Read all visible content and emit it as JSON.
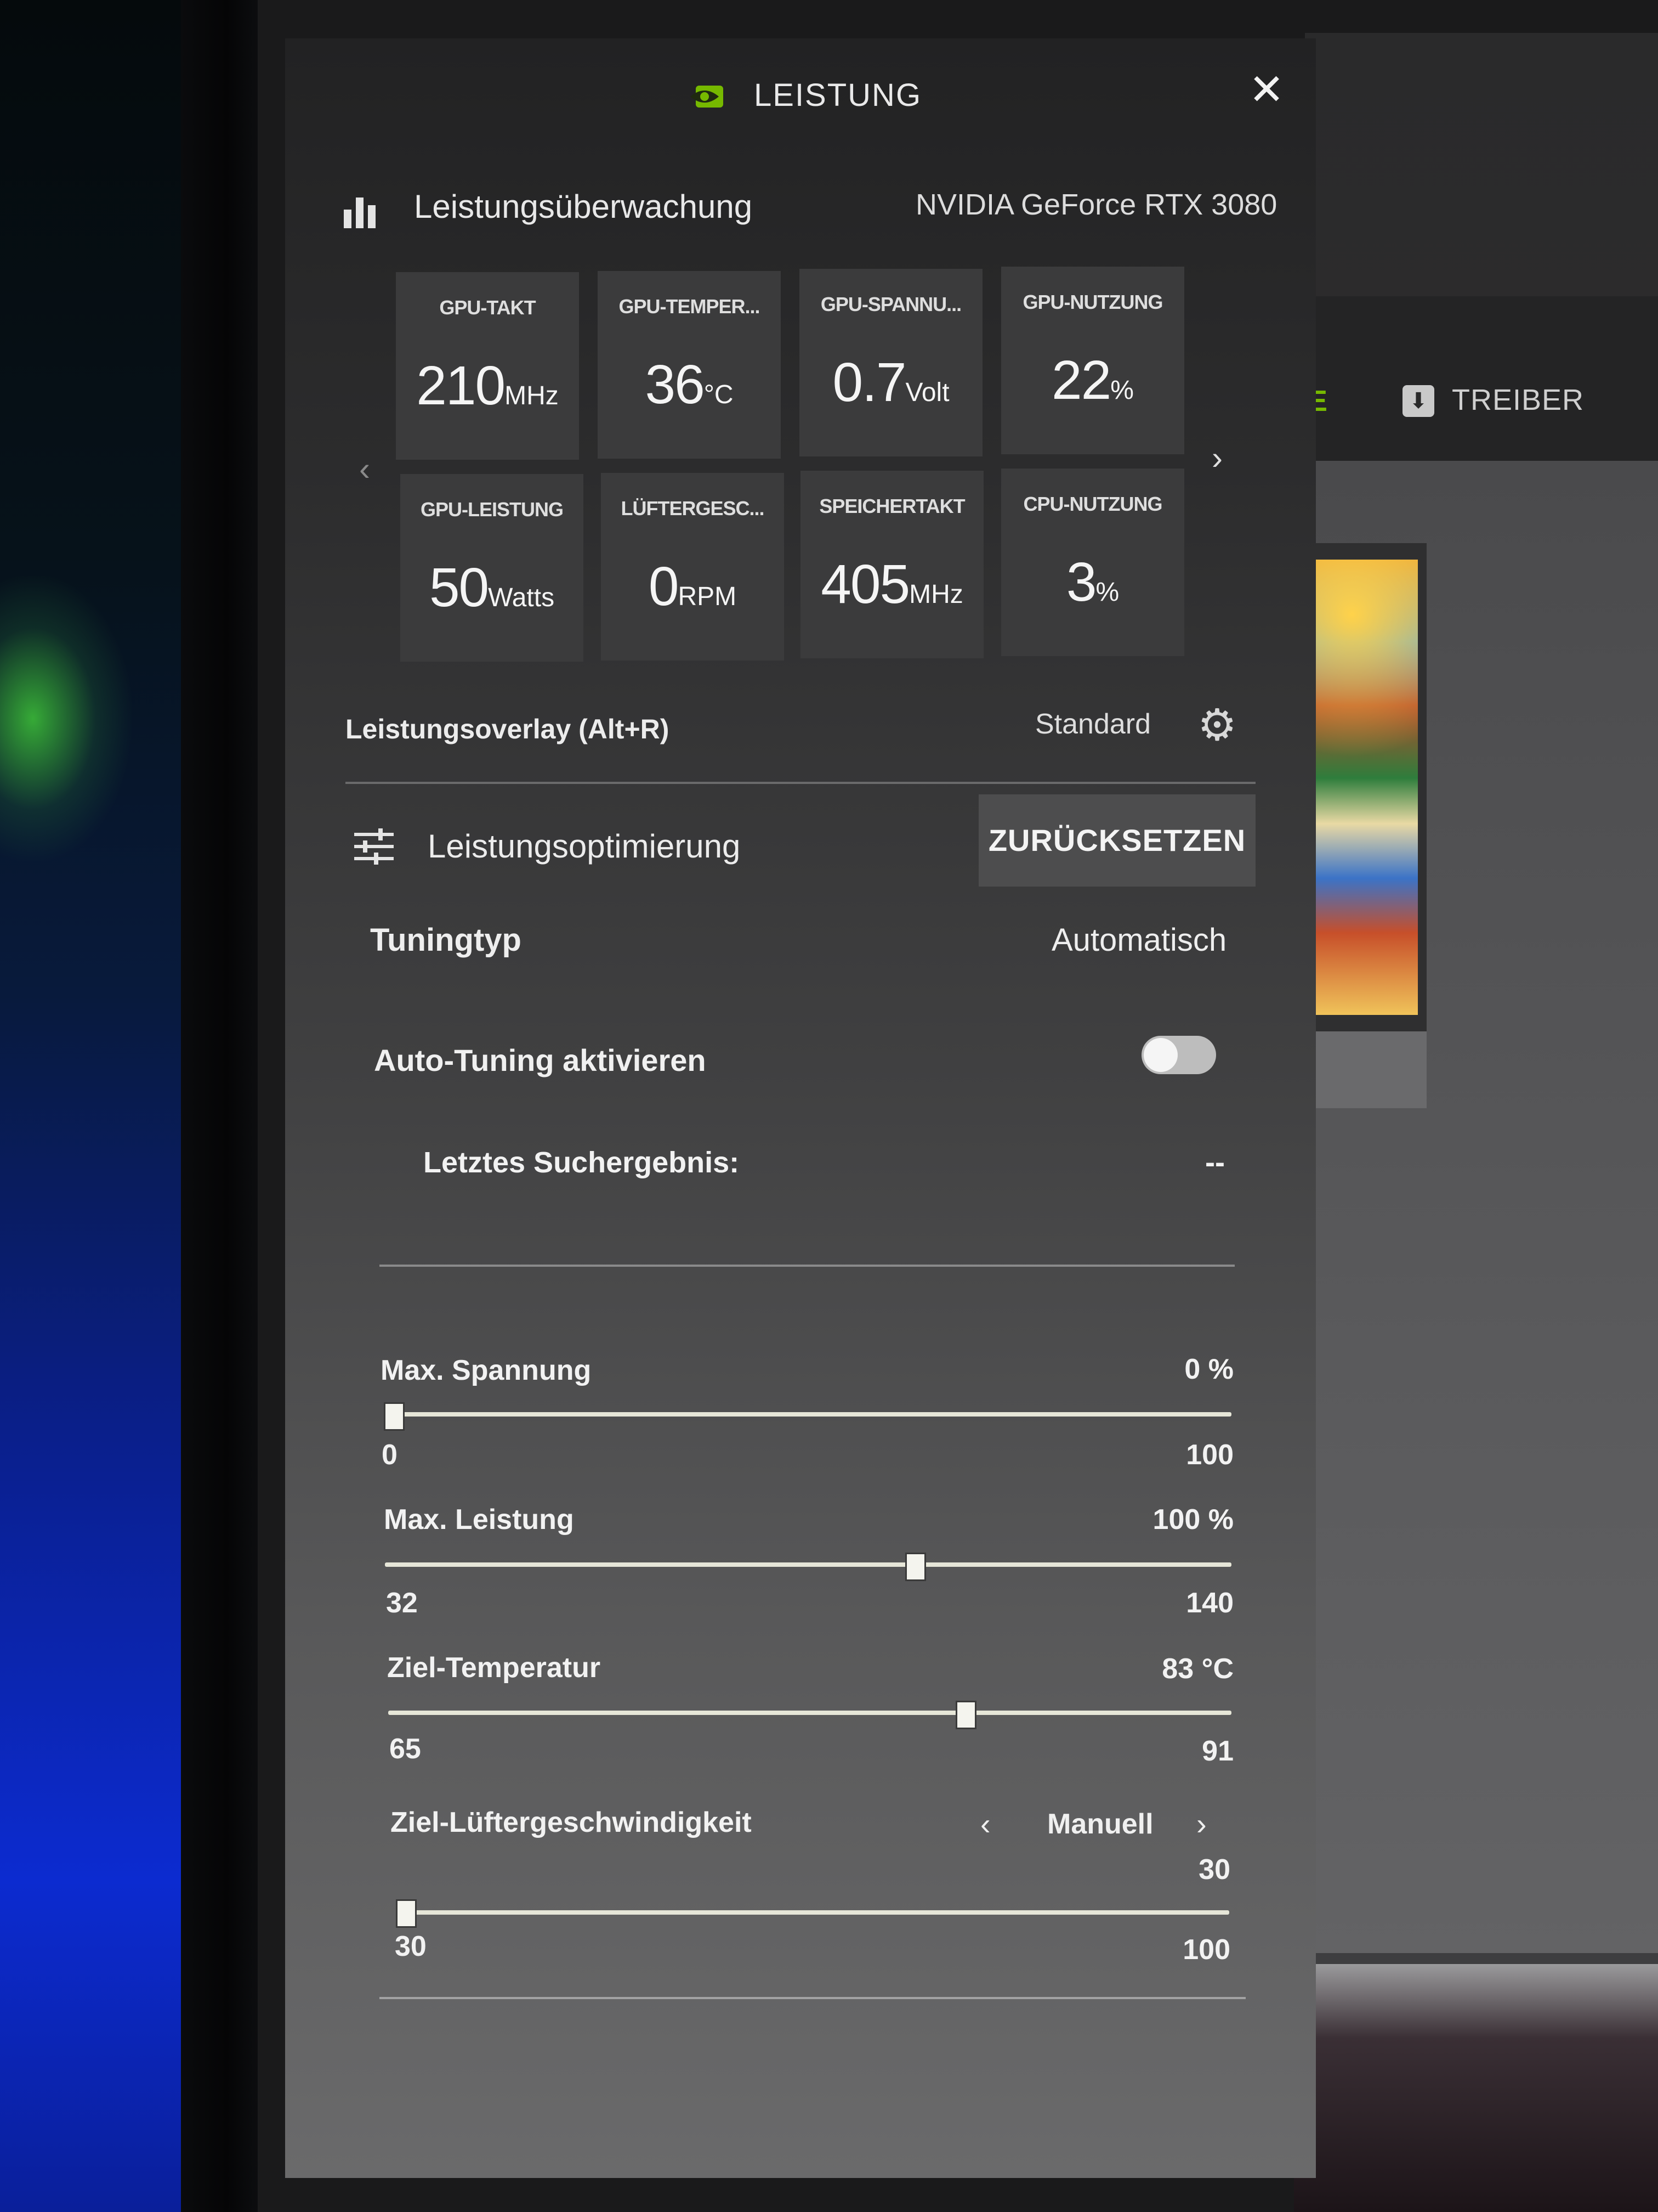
{
  "header": {
    "title": "LEISTUNG",
    "close_label": "✕"
  },
  "monitoring": {
    "title": "Leistungsüberwachung",
    "gpu_name": "NVIDIA GeForce RTX 3080",
    "nav_prev": "‹",
    "nav_next": "›",
    "tiles": [
      {
        "label": "GPU-TAKT",
        "value": "210",
        "unit": "MHz"
      },
      {
        "label": "GPU-TEMPER...",
        "value": "36",
        "unit": "°C"
      },
      {
        "label": "GPU-SPANNU...",
        "value": "0.7",
        "unit": "Volt"
      },
      {
        "label": "GPU-NUTZUNG",
        "value": "22",
        "unit": "%"
      },
      {
        "label": "GPU-LEISTUNG",
        "value": "50",
        "unit": "Watts"
      },
      {
        "label": "LÜFTERGESC...",
        "value": "0",
        "unit": "RPM"
      },
      {
        "label": "SPEICHERTAKT",
        "value": "405",
        "unit": "MHz"
      },
      {
        "label": "CPU-NUTZUNG",
        "value": "3",
        "unit": "%"
      }
    ]
  },
  "overlay": {
    "label": "Leistungsoverlay (Alt+R)",
    "value": "Standard"
  },
  "optimization": {
    "title": "Leistungsoptimierung",
    "reset_label": "ZURÜCKSETZEN",
    "tuning_type_label": "Tuningtyp",
    "tuning_type_value": "Automatisch",
    "auto_tuning_label": "Auto-Tuning aktivieren",
    "auto_tuning_enabled": false,
    "last_search_label": "Letztes Suchergebnis:",
    "last_search_value": "--"
  },
  "sliders": [
    {
      "label": "Max. Spannung",
      "value": "0 %",
      "min": "0",
      "max": "100",
      "level": 0
    },
    {
      "label": "Max. Leistung",
      "value": "100 %",
      "min": "32",
      "max": "140",
      "level": 0.63
    },
    {
      "label": "Ziel-Temperatur",
      "value": "83 °C",
      "min": "65",
      "max": "91",
      "level": 0.69
    },
    {
      "label": "Ziel-Lüftergeschwindigkeit",
      "value": "30",
      "min": "30",
      "max": "100",
      "level": 0,
      "mode": "Manuell",
      "mode_prev": "‹",
      "mode_next": "›"
    }
  ],
  "background_app": {
    "tab_partial": "E",
    "driver_tab": "TREIBER"
  },
  "colors": {
    "nvidia_green": "#76b900",
    "tile_bg": "#3b3b3c",
    "panel_bg": "#2c2c2d"
  }
}
